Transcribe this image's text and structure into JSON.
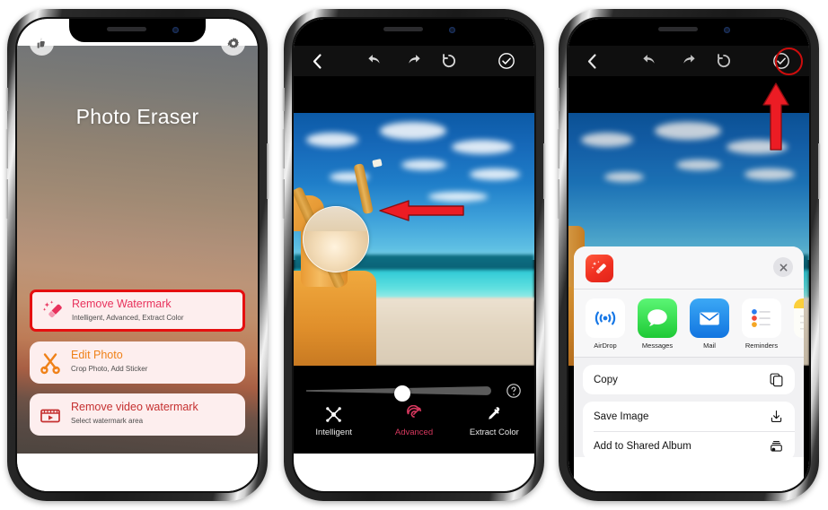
{
  "app": {
    "name": "Photo Eraser",
    "accent_red": "#e8325c",
    "accent_orange": "#ef8118",
    "highlight_red": "#e50f0f"
  },
  "phone1": {
    "title": "Photo Eraser",
    "like_icon": "thumbs-up-icon",
    "settings_icon": "gear-icon",
    "menu": [
      {
        "title": "Remove Watermark",
        "subtitle": "Intelligent, Advanced, Extract Color",
        "icon": "eraser-sparkle-icon",
        "highlighted": "true"
      },
      {
        "title": "Edit Photo",
        "subtitle": "Crop Photo, Add Sticker",
        "icon": "scissors-icon",
        "highlighted": "false"
      },
      {
        "title": "Remove video watermark",
        "subtitle": "Select watermark area",
        "icon": "film-play-icon",
        "highlighted": "false"
      }
    ]
  },
  "phone2": {
    "toolbar": {
      "back": "back-chevron-icon",
      "undo": "undo-icon",
      "redo": "redo-icon",
      "reset": "reset-icon",
      "confirm": "check-circle-icon"
    },
    "slider": {
      "label": "brush-size-slider",
      "value": "52",
      "help": "help-icon"
    },
    "tabs": [
      {
        "label": "Intelligent",
        "icon": "intelligent-icon",
        "active": "false"
      },
      {
        "label": "Advanced",
        "icon": "target-icon",
        "active": "true"
      },
      {
        "label": "Extract Color",
        "icon": "eyedropper-icon",
        "active": "false"
      }
    ],
    "annotation": "red-arrow-pointing-left-at-magnifier"
  },
  "phone3": {
    "toolbar": {
      "back": "back-chevron-icon",
      "undo": "undo-icon",
      "redo": "redo-icon",
      "reset": "reset-icon",
      "confirm": "check-circle-icon"
    },
    "annotation": "red-arrow-pointing-up-at-confirm",
    "share_sheet": {
      "app_icon": "photo-eraser-app-icon",
      "close": "close-icon",
      "apps": [
        {
          "label": "AirDrop",
          "icon": "airdrop-icon"
        },
        {
          "label": "Messages",
          "icon": "messages-icon"
        },
        {
          "label": "Mail",
          "icon": "mail-icon"
        },
        {
          "label": "Reminders",
          "icon": "reminders-icon"
        },
        {
          "label": "",
          "icon": "notes-icon"
        }
      ],
      "actions": [
        {
          "label": "Copy",
          "icon": "copy-icon"
        },
        {
          "label": "Save Image",
          "icon": "download-icon"
        },
        {
          "label": "Add to Shared Album",
          "icon": "shared-album-icon"
        }
      ]
    }
  }
}
